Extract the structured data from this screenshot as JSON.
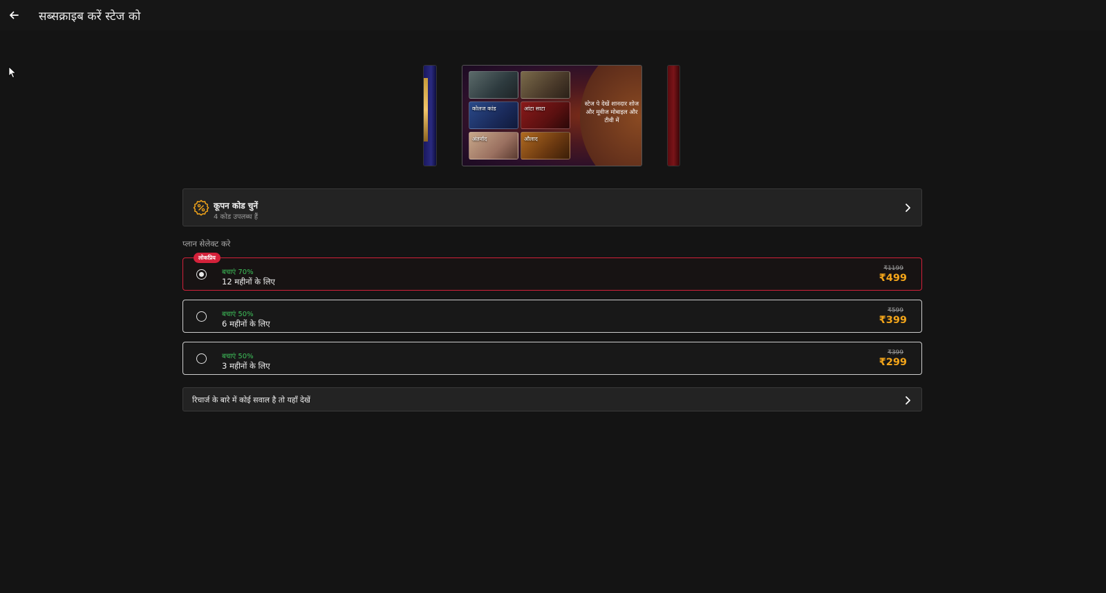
{
  "header": {
    "title": "सब्सक्राइब करें स्टेज को",
    "back_icon": "arrow-left-icon"
  },
  "carousel": {
    "promo_text": "स्टेज पे देखें शानदार शोज और मूवीज मोबाइल और टीवी में",
    "thumbnails": [
      "",
      "",
      "कोलज कांड",
      "आंटा साटा",
      "अंतर्नाद",
      "औलाद"
    ]
  },
  "coupon": {
    "title": "कूपन कोड चुनें",
    "subtitle": "4 कोड उपलब्ध हैं",
    "icon": "discount-badge-icon"
  },
  "plans_heading": "प्लान सेलेक्ट करे",
  "popular_badge": "लोकप्रिय",
  "plans": [
    {
      "save": "बचाएं 70%",
      "duration": "12 महीनों के लिए",
      "original_price": "₹1199",
      "price": "₹499",
      "selected": true
    },
    {
      "save": "बचाएं 50%",
      "duration": "6 महीनों के लिए",
      "original_price": "₹599",
      "price": "₹399",
      "selected": false
    },
    {
      "save": "बचाएं 50%",
      "duration": "3 महीनों के लिए",
      "original_price": "₹399",
      "price": "₹299",
      "selected": false
    }
  ],
  "faq": {
    "text": "रिचार्ज के बारे में कोई सवाल है तो यहाँ देखें"
  },
  "colors": {
    "background": "#141414",
    "accent_red": "#d4213a",
    "save_green": "#3ec15a",
    "price_orange": "#f3a51a"
  }
}
